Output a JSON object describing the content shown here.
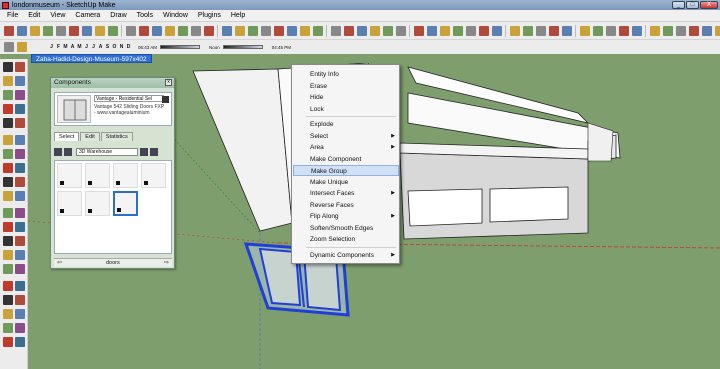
{
  "window": {
    "title": "londonmuseum - SketchUp Make",
    "minimize": "_",
    "maximize": "□",
    "close": "X"
  },
  "menubar": [
    "File",
    "Edit",
    "View",
    "Camera",
    "Draw",
    "Tools",
    "Window",
    "Plugins",
    "Help"
  ],
  "shadow_toolbar": {
    "months": [
      "J",
      "F",
      "M",
      "A",
      "M",
      "J",
      "J",
      "A",
      "S",
      "O",
      "N",
      "D"
    ],
    "time_start": "06:43 AM",
    "time_noon": "Noon",
    "time_end": "04:45 PM"
  },
  "scene_tab": "Zaha-Hadid-Design-Museum-597x402",
  "components": {
    "title": "Components",
    "close": "x",
    "name_value": "Vantage - Residential Sel",
    "description": "Vantage 542 Sliding Doors FXP - www.vantagealuminium",
    "tabs": [
      "Select",
      "Edit",
      "Statistics"
    ],
    "search_value": "3D Warehouse",
    "footer_label": "doors",
    "back_arrow": "⇦",
    "forward_arrow": "⇨"
  },
  "context_menu": {
    "items": [
      {
        "label": "Entity Info",
        "submenu": false
      },
      {
        "label": "Erase",
        "submenu": false
      },
      {
        "label": "Hide",
        "submenu": false
      },
      {
        "label": "Lock",
        "submenu": false
      },
      {
        "label": "Explode",
        "submenu": false
      },
      {
        "label": "Select",
        "submenu": true
      },
      {
        "label": "Area",
        "submenu": true
      },
      {
        "label": "Make Component",
        "submenu": false
      },
      {
        "label": "Make Group",
        "submenu": false,
        "highlighted": true
      },
      {
        "label": "Make Unique",
        "submenu": false
      },
      {
        "label": "Intersect Faces",
        "submenu": true
      },
      {
        "label": "Reverse Faces",
        "submenu": false
      },
      {
        "label": "Flip Along",
        "submenu": true
      },
      {
        "label": "Soften/Smooth Edges",
        "submenu": false
      },
      {
        "label": "Zoom Selection",
        "submenu": false
      },
      {
        "label": "Dynamic Components",
        "submenu": true
      }
    ],
    "submenu_arrow": "▶"
  },
  "colors": {
    "selection_blue": "#1f3fd8",
    "ground_green": "#7f9e6e",
    "highlight": "#cfe0f7"
  }
}
